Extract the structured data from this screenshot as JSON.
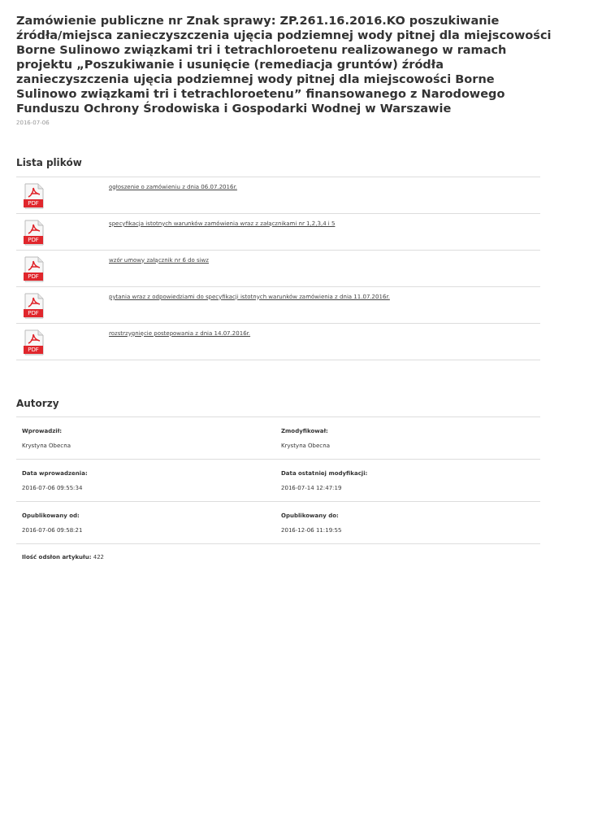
{
  "title": "Zamówienie publiczne nr Znak sprawy: ZP.261.16.2016.KO poszukiwanie źródła/miejsca zanieczyszczenia ujęcia podziemnej wody pitnej dla miejscowości Borne Sulinowo związkami tri i tetrachloroetenu realizowanego w ramach projektu „Poszukiwanie i usunięcie (remediacja gruntów) źródła zanieczyszczenia ujęcia podziemnej wody pitnej dla miejscowości Borne Sulinowo związkami tri i tetrachloroetenu” finansowanego z Narodowego Funduszu Ochrony Środowiska i Gospodarki Wodnej w Warszawie",
  "date": "2016-07-06",
  "files": {
    "heading": "Lista plików",
    "items": [
      {
        "icon_label": "PDF",
        "name": "ogłoszenie o zamówieniu z dnia 06.07.2016r."
      },
      {
        "icon_label": "PDF",
        "name": "specyfikacja istotnych warunków zamówienia wraz z załącznikami nr 1,2,3,4 i 5"
      },
      {
        "icon_label": "PDF",
        "name": "wzór umowy załącznik nr 6 do siwz"
      },
      {
        "icon_label": "PDF",
        "name": "pytania wraz z odpowiedziami do specyfikacji istotnych warunków zamówienia z dnia 11.07.2016r."
      },
      {
        "icon_label": "PDF",
        "name": "rozstrzygnięcie postepowania z dnia 14.07.2016r."
      }
    ]
  },
  "authors": {
    "heading": "Autorzy",
    "rows": [
      [
        {
          "label": "Wprowadził:",
          "value": "Krystyna Obecna"
        },
        {
          "label": "Zmodyfikował:",
          "value": "Krystyna Obecna"
        }
      ],
      [
        {
          "label": "Data wprowadzenia:",
          "value": "2016-07-06 09:55:34"
        },
        {
          "label": "Data ostatniej modyfikacji:",
          "value": "2016-07-14 12:47:19"
        }
      ],
      [
        {
          "label": "Opublikowany od:",
          "value": "2016-07-06 09:58:21"
        },
        {
          "label": "Opublikowany do:",
          "value": "2016-12-06 11:19:55"
        }
      ]
    ],
    "views": "**Ilość odsłon artykułu:** 422"
  }
}
